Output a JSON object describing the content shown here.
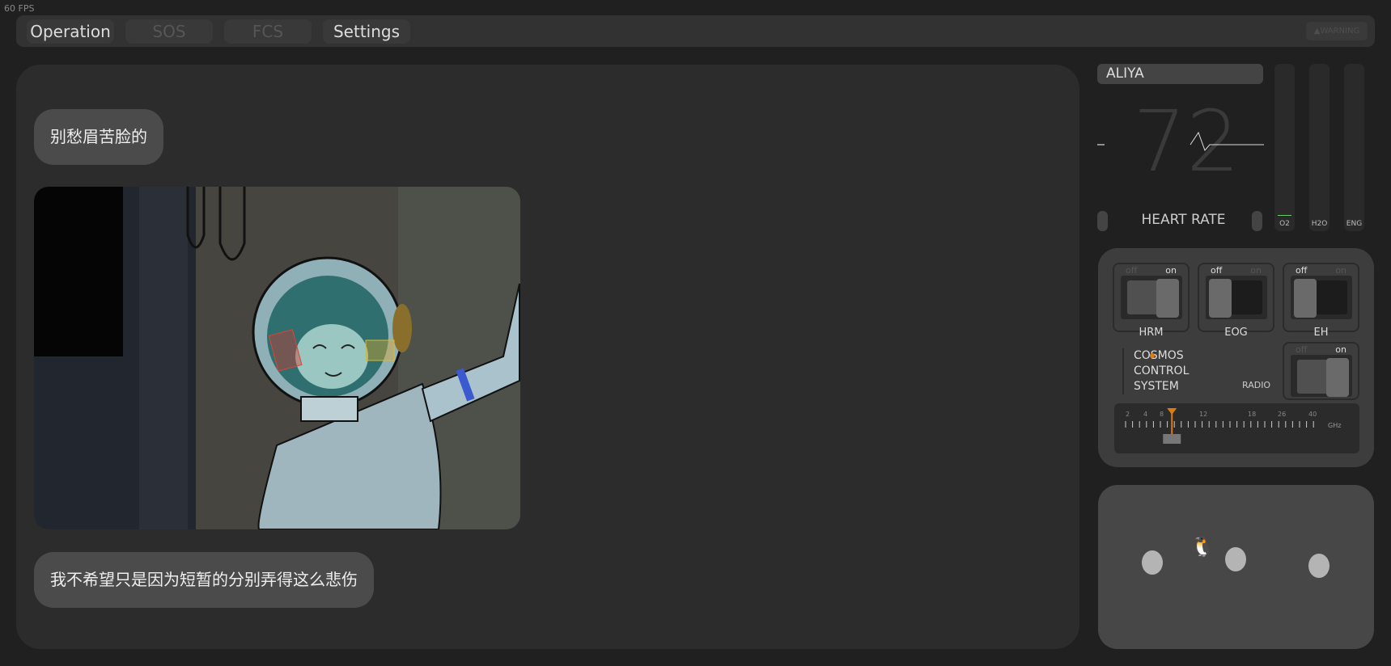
{
  "fps": "60 FPS",
  "tabs": [
    {
      "label": "Operation"
    },
    {
      "label": "SOS"
    },
    {
      "label": "FCS"
    },
    {
      "label": "Settings"
    }
  ],
  "warning": {
    "label": "WARNING",
    "icon": "warning-icon"
  },
  "chat": {
    "messages": [
      {
        "text": "别愁眉苦脸的"
      },
      {
        "image": "astronaut girl in helmet smiling, waving"
      },
      {
        "text": "我不希望只是因为短暂的分别弄得这么悲伤"
      }
    ]
  },
  "status": {
    "name": "ALIYA",
    "heart_rate": "72",
    "heart_rate_label": "HEART RATE",
    "gauges": [
      {
        "label": "O2",
        "level": 0
      },
      {
        "label": "H2O",
        "level": 0
      },
      {
        "label": "ENG",
        "level": 0
      }
    ]
  },
  "controls": {
    "switches": [
      {
        "label": "HRM",
        "off": "off",
        "on": "on",
        "state": "on"
      },
      {
        "label": "EOG",
        "off": "off",
        "on": "on",
        "state": "off"
      },
      {
        "label": "EH",
        "off": "off",
        "on": "on",
        "state": "off"
      }
    ],
    "system_name": [
      "COSMOS",
      "CONTROL",
      "SYSTEM"
    ],
    "radio": {
      "label": "RADIO",
      "off": "off",
      "on": "on",
      "state": "on"
    },
    "tuner": {
      "ticks": [
        "2",
        "4",
        "8",
        "12",
        "18",
        "26",
        "40"
      ],
      "unit": "GHz",
      "value_ghz": 9,
      "accent": "#e07b10"
    }
  },
  "colors": {
    "bg": "#202020",
    "panel": "#2c2c2c",
    "bubble": "#4b4b4b",
    "accent": "#e07b10"
  }
}
